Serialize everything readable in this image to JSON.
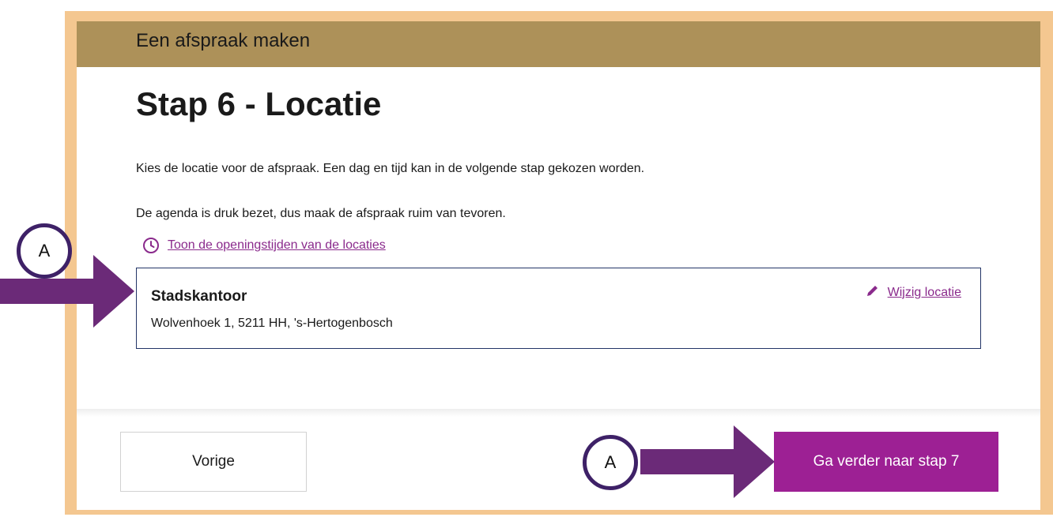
{
  "header": {
    "title": "Een afspraak maken"
  },
  "step": {
    "title": "Stap 6 - Locatie"
  },
  "intro": {
    "line1": "Kies de locatie voor de afspraak. Een dag en tijd kan in de volgende stap gekozen worden.",
    "line2": "De agenda is druk bezet, dus maak de afspraak ruim van tevoren."
  },
  "opening_hours_link": {
    "label": "Toon de openingstijden van de locaties",
    "icon": "clock-icon"
  },
  "location": {
    "name": "Stadskantoor",
    "address": "Wolvenhoek 1, 5211 HH, 's-Hertogenbosch",
    "change_label": "Wijzig locatie",
    "change_icon": "pencil-icon"
  },
  "footer": {
    "previous_label": "Vorige",
    "next_label": "Ga verder naar stap 7"
  },
  "annotations": {
    "marker_label": "A"
  },
  "colors": {
    "frame": "#f4c790",
    "header_bar": "#ad9159",
    "accent": "#9d2094",
    "link": "#8a2a8c",
    "box_border": "#233567",
    "annotation_arrow": "#6b2a78",
    "annotation_circle": "#3e2167"
  }
}
